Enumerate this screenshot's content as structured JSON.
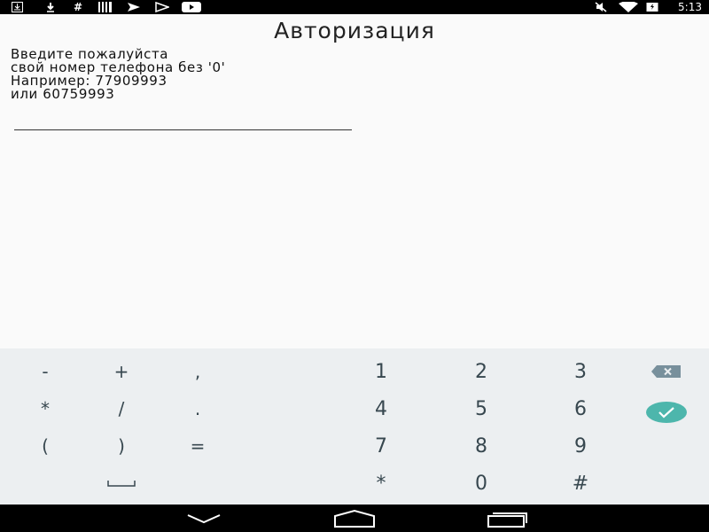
{
  "status_bar": {
    "left_icons": [
      "download-box-icon",
      "download-icon",
      "hashtag-icon",
      "barcode-icon",
      "send-flag-icon",
      "play-store-icon",
      "youtube-icon"
    ],
    "right_icons": [
      "mute-icon",
      "wifi-icon",
      "battery-icon"
    ],
    "time": "5:13"
  },
  "page": {
    "title": "Авторизация",
    "instructions": [
      "Введите пожалуйста",
      "свой номер телефона без '0'",
      "Например: 77909993",
      "или 60759993"
    ],
    "phone_input": {
      "value": "",
      "placeholder": ""
    }
  },
  "keyboard": {
    "symbols": [
      "-",
      "+",
      ",",
      "*",
      "/",
      ".",
      "(",
      ")",
      "=",
      "␣"
    ],
    "digits": [
      "1",
      "2",
      "3",
      "4",
      "5",
      "6",
      "7",
      "8",
      "9",
      "*",
      "0",
      "#"
    ],
    "action_icons": [
      "backspace-icon",
      "done-check-icon"
    ],
    "accent_color": "#4db6ac"
  },
  "nav_bar": {
    "icons": [
      "back-icon",
      "home-icon",
      "recents-icon"
    ]
  }
}
